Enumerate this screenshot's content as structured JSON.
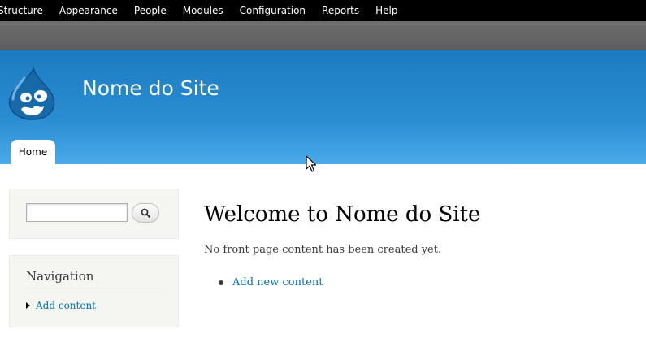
{
  "toolbar": {
    "items": [
      "Structure",
      "Appearance",
      "People",
      "Modules",
      "Configuration",
      "Reports",
      "Help"
    ]
  },
  "header": {
    "site_name": "Nome do Site",
    "tab_home": "Home"
  },
  "search": {
    "value": "",
    "button_icon": "search-icon"
  },
  "navigation": {
    "title": "Navigation",
    "items": [
      "Add content"
    ]
  },
  "main": {
    "title": "Welcome to Nome do Site",
    "empty_text": "No front page content has been created yet.",
    "links": [
      "Add new content"
    ]
  },
  "colors": {
    "toolbar": "#000000",
    "header_top": "#1c7bc0",
    "header_bottom": "#4aaaea",
    "link": "#0071b3",
    "sidebar_block": "#f5f5f2"
  }
}
